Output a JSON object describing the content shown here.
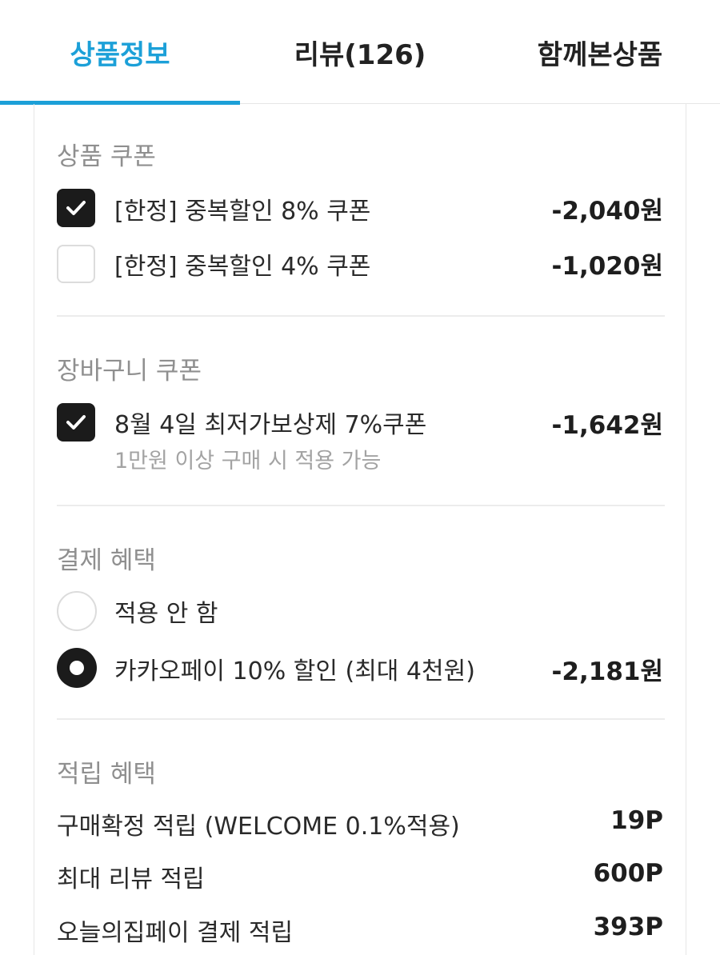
{
  "tabs": [
    {
      "label": "상품정보",
      "active": true
    },
    {
      "label": "리뷰(126)",
      "active": false
    },
    {
      "label": "함께본상품",
      "active": false
    }
  ],
  "colors": {
    "accent": "#1ca0d8",
    "checked": "#1b1b1b",
    "divider": "#ececec"
  },
  "product_coupon": {
    "title": "상품 쿠폰",
    "items": [
      {
        "label": "[한정] 중복할인 8% 쿠폰",
        "amount": "-2,040원",
        "checked": true
      },
      {
        "label": "[한정] 중복할인 4% 쿠폰",
        "amount": "-1,020원",
        "checked": false
      }
    ]
  },
  "cart_coupon": {
    "title": "장바구니 쿠폰",
    "items": [
      {
        "label": "8월 4일 최저가보상제 7%쿠폰",
        "sub": "1만원 이상 구매 시 적용 가능",
        "amount": "-1,642원",
        "checked": true
      }
    ]
  },
  "payment_benefit": {
    "title": "결제 혜택",
    "options": [
      {
        "label": "적용 안 함",
        "selected": false
      },
      {
        "label": "카카오페이 10% 할인 (최대 4천원)",
        "amount": "-2,181원",
        "selected": true
      }
    ]
  },
  "reward_benefit": {
    "title": "적립 혜택",
    "items": [
      {
        "label": "구매확정 적립 (WELCOME 0.1%적용)",
        "amount": "19P"
      },
      {
        "label": "최대 리뷰 적립",
        "amount": "600P"
      },
      {
        "label": "오늘의집페이 결제 적립",
        "amount": "393P"
      }
    ]
  }
}
